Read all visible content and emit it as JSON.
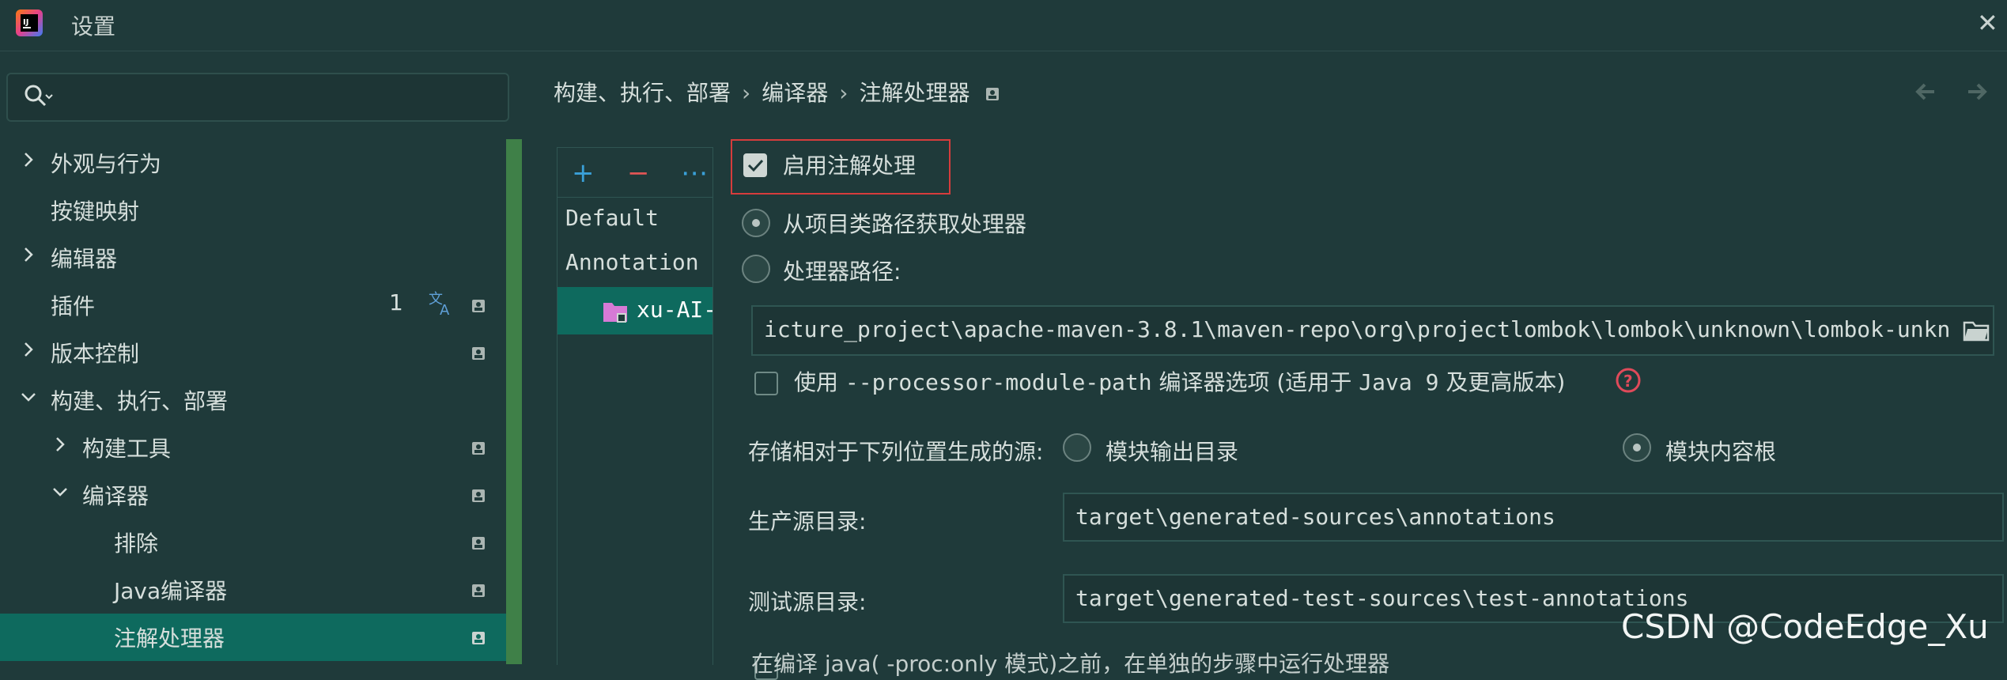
{
  "window": {
    "title": "设置",
    "close_glyph": "✕"
  },
  "search": {
    "placeholder": ""
  },
  "sidebar": {
    "items": [
      {
        "label": "外观与行为",
        "expand": "collapsed",
        "indent": 0
      },
      {
        "label": "按键映射",
        "expand": "none",
        "indent": 0
      },
      {
        "label": "编辑器",
        "expand": "collapsed",
        "indent": 0
      },
      {
        "label": "插件",
        "expand": "none",
        "indent": 0,
        "count": "1"
      },
      {
        "label": "版本控制",
        "expand": "collapsed",
        "indent": 0
      },
      {
        "label": "构建、执行、部署",
        "expand": "expanded",
        "indent": 0
      },
      {
        "label": "构建工具",
        "expand": "collapsed",
        "indent": 1
      },
      {
        "label": "编译器",
        "expand": "expanded",
        "indent": 1
      },
      {
        "label": "排除",
        "expand": "none",
        "indent": 2
      },
      {
        "label": "Java编译器",
        "expand": "none",
        "indent": 2
      },
      {
        "label": "注解处理器",
        "expand": "none",
        "indent": 2,
        "selected": true
      }
    ]
  },
  "breadcrumb": {
    "items": [
      "构建、执行、部署",
      "编译器",
      "注解处理器"
    ],
    "separator": "›"
  },
  "profiles": {
    "toolbar": {
      "add": "+",
      "remove": "−",
      "more": "⋯"
    },
    "default_line1": "Default",
    "default_line2": "Annotation",
    "module": "xu-AI-"
  },
  "settings": {
    "enable_label": "启用注解处理",
    "enable_checked": true,
    "from_classpath_label": "从项目类路径获取处理器",
    "processor_path_label": "处理器路径:",
    "processor_path_value": "icture_project\\apache-maven-3.8.1\\maven-repo\\org\\projectlombok\\lombok\\unknown\\lombok-unknown.jar",
    "module_path_prefix": "使用 ",
    "module_path_flag": "--processor-module-path",
    "module_path_middle": " 编译器选项 (适用于 ",
    "module_path_java": "Java 9",
    "module_path_suffix": " 及更高版本)",
    "store_label": "存储相对于下列位置生成的源:",
    "store_option_output": "模块输出目录",
    "store_option_content_root": "模块内容根",
    "store_selected": "模块内容根",
    "prod_dir_label": "生产源目录:",
    "prod_dir_value": "target\\generated-sources\\annotations",
    "test_dir_label": "测试源目录:",
    "test_dir_value": "target\\generated-test-sources\\test-annotations",
    "cutoff_text": "在编译 java( -proc:only 模式)之前，在单独的步骤中运行处理器"
  },
  "watermark": "CSDN @CodeEdge_Xu",
  "colors": {
    "background": "#1f3a3a",
    "selection": "#0e6a5e",
    "scrollbar": "#3f8048",
    "highlight_border": "#d63c3c",
    "add_icon": "#3aa0d8",
    "remove_icon": "#e05555",
    "help_icon": "#e04a5a"
  }
}
